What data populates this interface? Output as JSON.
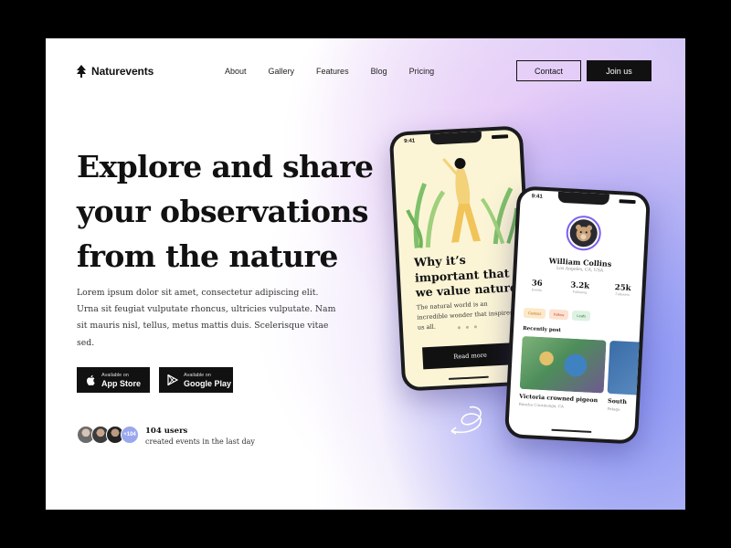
{
  "brand": {
    "name": "Naturevents"
  },
  "nav": {
    "items": [
      "About",
      "Gallery",
      "Features",
      "Blog",
      "Pricing"
    ]
  },
  "header": {
    "contact_label": "Contact",
    "join_label": "Join us"
  },
  "hero": {
    "title_lines": [
      "Explore and share",
      "your observations",
      "from the nature"
    ],
    "description": "Lorem ipsum dolor sit amet, consectetur adipiscing elit. Urna sit feugiat vulputate rhoncus, ultricies vulputate. Nam sit mauris nisl, tellus, metus mattis duis. Scelerisque vitae sed."
  },
  "stores": {
    "apple": {
      "small": "Available on",
      "big": "App Store"
    },
    "google": {
      "small": "Available on",
      "big": "Google Play"
    }
  },
  "users": {
    "count_badge": "+104",
    "title": "104 users",
    "subtitle": "created events in the last day"
  },
  "phone1": {
    "time": "9:41",
    "title": "Why it’s important that we value nature",
    "text": "The natural world is an incredible wonder that inspires us all.",
    "button": "Read more"
  },
  "phone2": {
    "time": "9:41",
    "name": "William Collins",
    "location": "Los Angeles, CA, USA",
    "stats": [
      {
        "value": "36",
        "label": "Events"
      },
      {
        "value": "3.2k",
        "label": "Following"
      },
      {
        "value": "25k",
        "label": "Followers"
      }
    ],
    "chips": [
      "Contact",
      "Follow",
      "Leafs"
    ],
    "recent_label": "Recently post",
    "post_title": "Victoria crowned pigeon",
    "post_sub": "Rancho Cucamonga, CA",
    "post2_title": "South",
    "post2_sub": "Patago"
  },
  "colors": {
    "accent": "#7d5ff0",
    "dark": "#111111",
    "phone_cream": "#fbf5d6"
  }
}
